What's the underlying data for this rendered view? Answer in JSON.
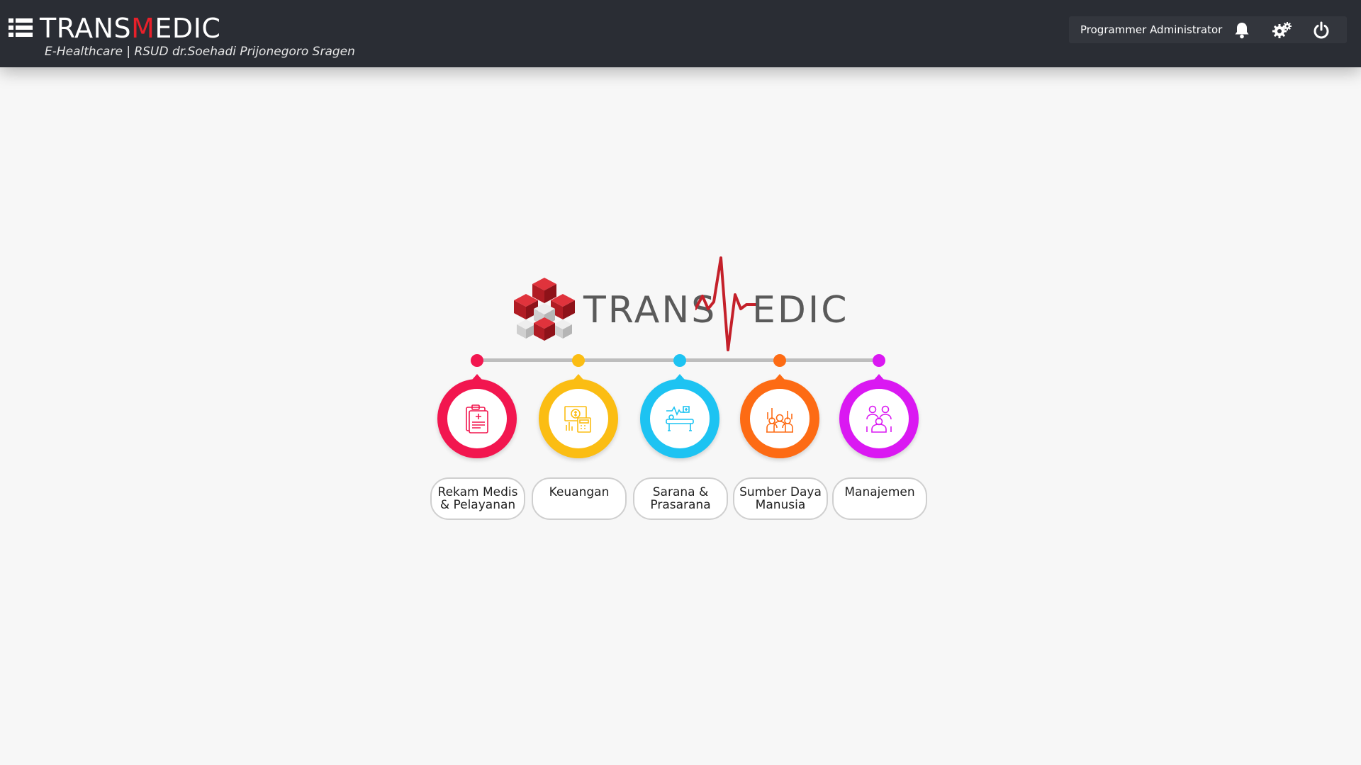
{
  "header": {
    "brand_prefix": "TRANS",
    "brand_accent": "M",
    "brand_suffix": "EDIC",
    "subtitle": "E-Healthcare | RSUD dr.Soehadi Prijonegoro Sragen",
    "user_name": "Programmer Administrator",
    "icons": [
      "list-menu-icon",
      "bell-icon",
      "gears-icon",
      "power-icon"
    ]
  },
  "logo": {
    "text_left": "TRANS",
    "text_right": "EDIC",
    "colors": {
      "cube_red": "#c4202a",
      "cube_gray": "#cfcfcf",
      "pulse": "#c4202a"
    }
  },
  "modules": [
    {
      "label": "Rekam Medis\n& Pelayanan",
      "color": "#f2164f",
      "icon": "medical-record-icon"
    },
    {
      "label": "Keuangan",
      "color": "#fbbd13",
      "icon": "finance-calculator-icon"
    },
    {
      "label": "Sarana &\nPrasarana",
      "color": "#1dc3f2",
      "icon": "hospital-bed-icon"
    },
    {
      "label": "Sumber Daya\nManusia",
      "color": "#fd6b14",
      "icon": "staff-group-icon"
    },
    {
      "label": "Manajemen",
      "color": "#da18f2",
      "icon": "management-team-icon"
    }
  ],
  "colors": {
    "topbar": "#2a2d34",
    "background": "#f7f7f7",
    "brand_accent": "#e8202a"
  }
}
